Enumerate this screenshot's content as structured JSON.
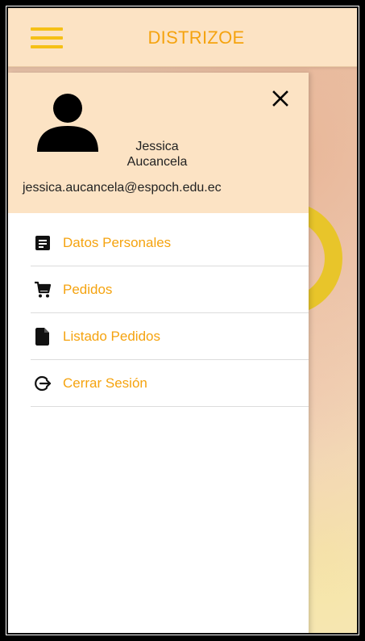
{
  "app": {
    "title": "DISTRIZOE",
    "accent_color": "#f5a30f",
    "hamburger_color": "#f5c016",
    "header_bg": "#fce3c4"
  },
  "drawer": {
    "user": {
      "avatar_icon": "person-icon",
      "name": "Jessica Aucancela",
      "email": "jessica.aucancela@espoch.edu.ec"
    },
    "close_icon": "close-icon",
    "menu": [
      {
        "label": "Datos Personales",
        "icon": "notes-icon"
      },
      {
        "label": "Pedidos",
        "icon": "shopping-cart-icon"
      },
      {
        "label": "Listado Pedidos",
        "icon": "document-icon"
      },
      {
        "label": "Cerrar Sesión",
        "icon": "logout-icon"
      }
    ]
  }
}
